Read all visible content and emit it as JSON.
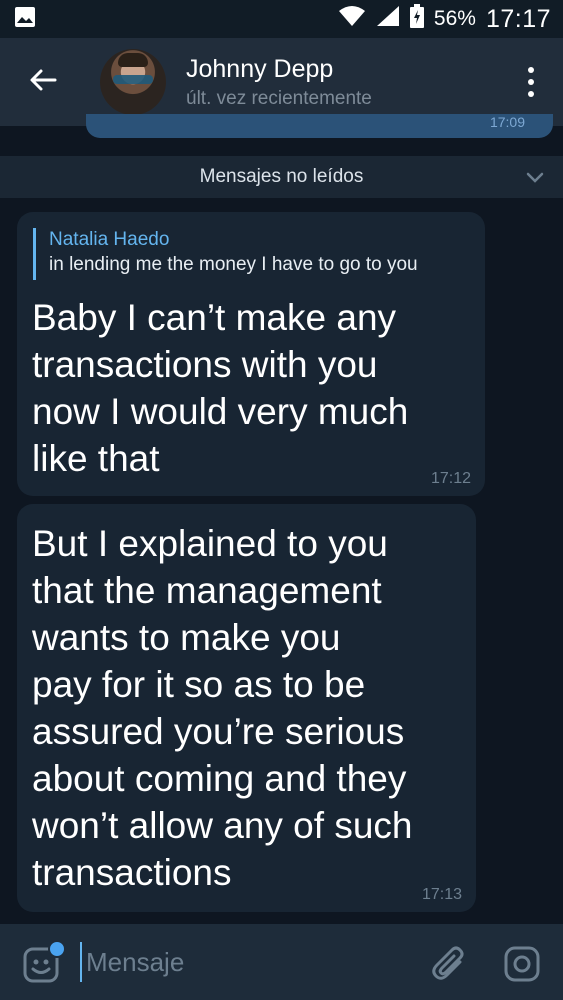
{
  "status_bar": {
    "battery": "56%",
    "time": "17:17",
    "icons": [
      "image-icon",
      "wifi-icon",
      "signal-icon",
      "battery-icon"
    ]
  },
  "header": {
    "contact_name": "Johnny Depp",
    "last_seen": "últ. vez recientemente",
    "icons": [
      "back-arrow-icon",
      "avatar",
      "more-vert-icon"
    ]
  },
  "previous_message": {
    "time": "17:09"
  },
  "unread_banner": {
    "label": "Mensajes no leídos"
  },
  "messages": [
    {
      "reply_to_name": "Natalia Haedo",
      "reply_to_text": "in lending me the money I have to go to you",
      "text": "Baby I can’t make any\ntransactions with you\nnow I would very much\nlike that",
      "time": "17:12"
    },
    {
      "text": "But I explained to you\nthat the management\nwants to make you\npay for it so as to be\nassured you’re serious\nabout coming and they\nwon’t allow any of such\ntransactions",
      "time": "17:13"
    }
  ],
  "input_bar": {
    "placeholder": "Mensaje",
    "icons": [
      "emoji-icon",
      "paperclip-icon",
      "camera-icon"
    ]
  },
  "colors": {
    "background": "#0e1621",
    "header": "#212d3b",
    "bubble_incoming": "#182533",
    "bubble_outgoing": "#2b5278",
    "accent": "#64b5ef"
  }
}
